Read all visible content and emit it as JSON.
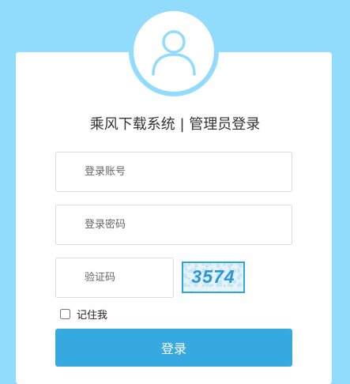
{
  "header": {
    "title": "乘风下载系统 | 管理员登录"
  },
  "form": {
    "username_placeholder": "登录账号",
    "password_placeholder": "登录密码",
    "captcha_placeholder": "验证码",
    "captcha_code": "3574",
    "remember_label": "记住我",
    "login_label": "登录"
  },
  "icons": {
    "avatar": "user-icon"
  },
  "colors": {
    "background": "#91dcfd",
    "accent": "#36aae0",
    "avatar_stroke": "#91dcfd"
  }
}
